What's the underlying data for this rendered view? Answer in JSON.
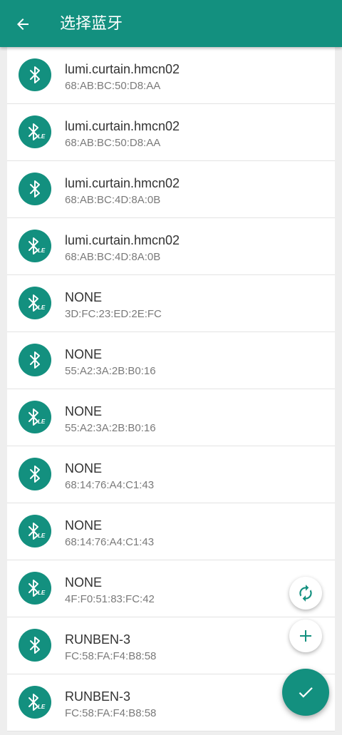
{
  "appbar": {
    "title": "选择蓝牙",
    "back_icon": "arrow-left-icon"
  },
  "colors": {
    "primary": "#13907f",
    "text": "#333333",
    "secondary_text": "#7a7a7a"
  },
  "devices": [
    {
      "name": "lumi.curtain.hmcn02",
      "address": "68:AB:BC:50:D8:AA",
      "badge": ""
    },
    {
      "name": "lumi.curtain.hmcn02",
      "address": "68:AB:BC:50:D8:AA",
      "badge": "LE"
    },
    {
      "name": "lumi.curtain.hmcn02",
      "address": "68:AB:BC:4D:8A:0B",
      "badge": ""
    },
    {
      "name": "lumi.curtain.hmcn02",
      "address": "68:AB:BC:4D:8A:0B",
      "badge": "LE"
    },
    {
      "name": "NONE",
      "address": "3D:FC:23:ED:2E:FC",
      "badge": "LE"
    },
    {
      "name": "NONE",
      "address": "55:A2:3A:2B:B0:16",
      "badge": ""
    },
    {
      "name": "NONE",
      "address": "55:A2:3A:2B:B0:16",
      "badge": "LE"
    },
    {
      "name": "NONE",
      "address": "68:14:76:A4:C1:43",
      "badge": ""
    },
    {
      "name": "NONE",
      "address": "68:14:76:A4:C1:43",
      "badge": "LE"
    },
    {
      "name": "NONE",
      "address": "4F:F0:51:83:FC:42",
      "badge": "LE"
    },
    {
      "name": "RUNBEN-3",
      "address": "FC:58:FA:F4:B8:58",
      "badge": ""
    },
    {
      "name": "RUNBEN-3",
      "address": "FC:58:FA:F4:B8:58",
      "badge": "LE"
    }
  ],
  "fabs": {
    "refresh_icon": "refresh-icon",
    "add_icon": "plus-icon",
    "confirm_icon": "check-icon"
  }
}
